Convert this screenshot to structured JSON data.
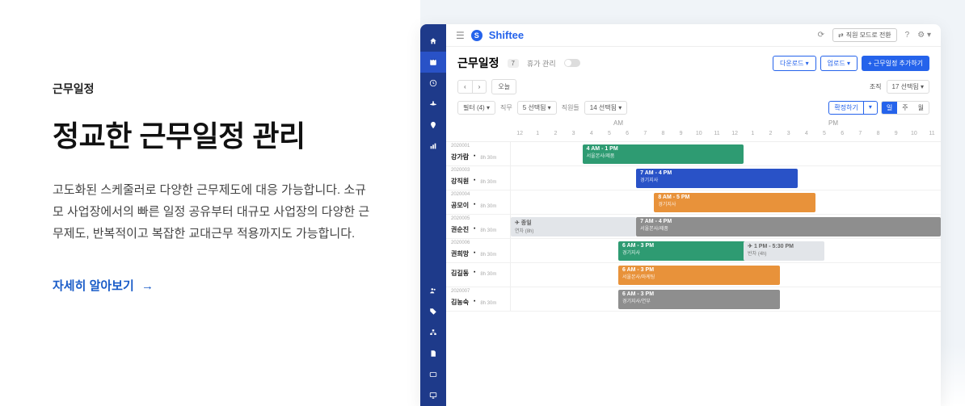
{
  "left": {
    "breadcrumb": "근무일정",
    "title": "정교한 근무일정 관리",
    "description": "고도화된 스케줄러로 다양한 근무제도에 대응 가능합니다. 소규모 사업장에서의 빠른 일정 공유부터 대규모 사업장의 다양한 근무제도, 반복적이고 복잡한 교대근무 적용까지도 가능합니다.",
    "learn_more": "자세히 알아보기"
  },
  "topbar": {
    "logo": "Shiftee",
    "mode_btn": "직원 모드로 전환"
  },
  "header": {
    "title": "근무일정",
    "count": "7",
    "leave_label": "휴가 관리",
    "download": "다운로드 ▾",
    "upload": "업로드 ▾",
    "add": "+  근무일정 추가하기"
  },
  "toolbar": {
    "today": "오늘",
    "org_label": "조직",
    "team_select": "17 선택됨 ▾"
  },
  "filters": {
    "filter": "필터 (4) ▾",
    "role_label": "직무",
    "role_select": "5 선택됨 ▾",
    "emp_label": "직원들",
    "emp_select": "14 선택됨 ▾",
    "confirm": "확정하기",
    "confirm_drop": "▾",
    "day": "일",
    "week": "주",
    "month": "월"
  },
  "ampm": {
    "am": "AM",
    "pm": "PM"
  },
  "hours": [
    "12",
    "1",
    "2",
    "3",
    "4",
    "5",
    "6",
    "7",
    "8",
    "9",
    "10",
    "11",
    "12",
    "1",
    "2",
    "3",
    "4",
    "5",
    "6",
    "7",
    "8",
    "9",
    "10",
    "11"
  ],
  "rows": [
    {
      "id": "2020001",
      "name": "강가람",
      "sub": "8h 30m",
      "shifts": [
        {
          "start": 4,
          "end": 13,
          "label": "4 AM - 1 PM",
          "loc": "서울본사/제품",
          "color": "#2e9b72"
        }
      ]
    },
    {
      "id": "2020003",
      "name": "강직원",
      "sub": "8h 30m",
      "shifts": [
        {
          "start": 7,
          "end": 16,
          "label": "7 AM - 4 PM",
          "loc": "경기지사",
          "color": "#2952c7"
        }
      ]
    },
    {
      "id": "2020004",
      "name": "공모이",
      "sub": "8h 30m",
      "shifts": [
        {
          "start": 8,
          "end": 17,
          "label": "8 AM - 5 PM",
          "loc": "경기지사",
          "color": "#e8923a"
        }
      ]
    },
    {
      "id": "2020005",
      "name": "권순진",
      "sub": "8h 30m",
      "shifts": [
        {
          "start": 0,
          "end": 7,
          "label": "✈ 종일",
          "loc": "연차 (8h)",
          "color": "gray"
        },
        {
          "start": 7,
          "end": 24,
          "label": "7 AM - 4 PM",
          "loc": "서울본사/제품",
          "color": "#8e8e8e"
        }
      ]
    },
    {
      "id": "2020006",
      "name": "권희망",
      "sub": "8h 30m",
      "shifts": [
        {
          "start": 6,
          "end": 15,
          "label": "6 AM - 3 PM",
          "loc": "경기지사",
          "color": "#2e9b72"
        },
        {
          "start": 13,
          "end": 17.5,
          "label": "✈ 1 PM - 5:30 PM",
          "loc": "반차 (4h)",
          "color": "gray"
        }
      ]
    },
    {
      "id": "",
      "name": "김길동",
      "sub": "8h 30m",
      "shifts": [
        {
          "start": 6,
          "end": 15,
          "label": "6 AM - 3 PM",
          "loc": "서울본사/마케팅",
          "color": "#e8923a"
        }
      ]
    },
    {
      "id": "2020007",
      "name": "김농숙",
      "sub": "8h 30m",
      "shifts": [
        {
          "start": 6,
          "end": 15,
          "label": "6 AM - 3 PM",
          "loc": "경기지사/연부",
          "color": "#8e8e8e"
        }
      ]
    }
  ]
}
